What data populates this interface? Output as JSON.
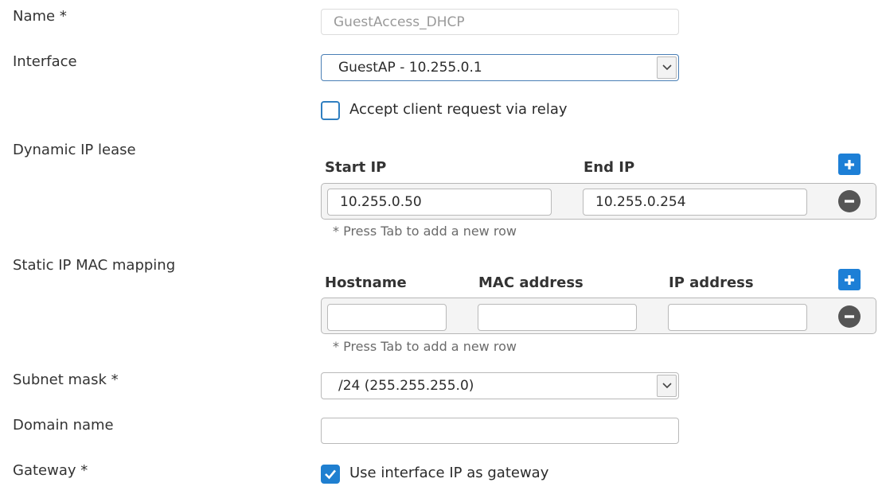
{
  "fields": {
    "name": {
      "label": "Name *",
      "value": "GuestAccess_DHCP"
    },
    "interface": {
      "label": "Interface",
      "value": "GuestAP - 10.255.0.1"
    },
    "relay": {
      "label": "Accept client request via relay",
      "checked": false
    },
    "dynamic_ip_lease": {
      "label": "Dynamic IP lease",
      "columns": [
        "Start IP",
        "End IP"
      ],
      "rows": [
        {
          "start_ip": "10.255.0.50",
          "end_ip": "10.255.0.254"
        }
      ],
      "hint": "* Press Tab to add a new row"
    },
    "static_mapping": {
      "label": "Static IP MAC mapping",
      "columns": [
        "Hostname",
        "MAC address",
        "IP address"
      ],
      "rows": [
        {
          "hostname": "",
          "mac": "",
          "ip": ""
        }
      ],
      "hint": "* Press Tab to add a new row"
    },
    "subnet_mask": {
      "label": "Subnet mask *",
      "value": "/24 (255.255.255.0)"
    },
    "domain_name": {
      "label": "Domain name",
      "value": ""
    },
    "gateway": {
      "label": "Gateway *",
      "checkbox_label": "Use interface IP as gateway",
      "checked": true
    }
  },
  "icons": {
    "add": "plus-icon",
    "remove": "minus-circle-icon",
    "dropdown": "chevron-down-icon",
    "check": "check-icon"
  },
  "colors": {
    "accent": "#1d7fd6",
    "remove": "#555555"
  }
}
